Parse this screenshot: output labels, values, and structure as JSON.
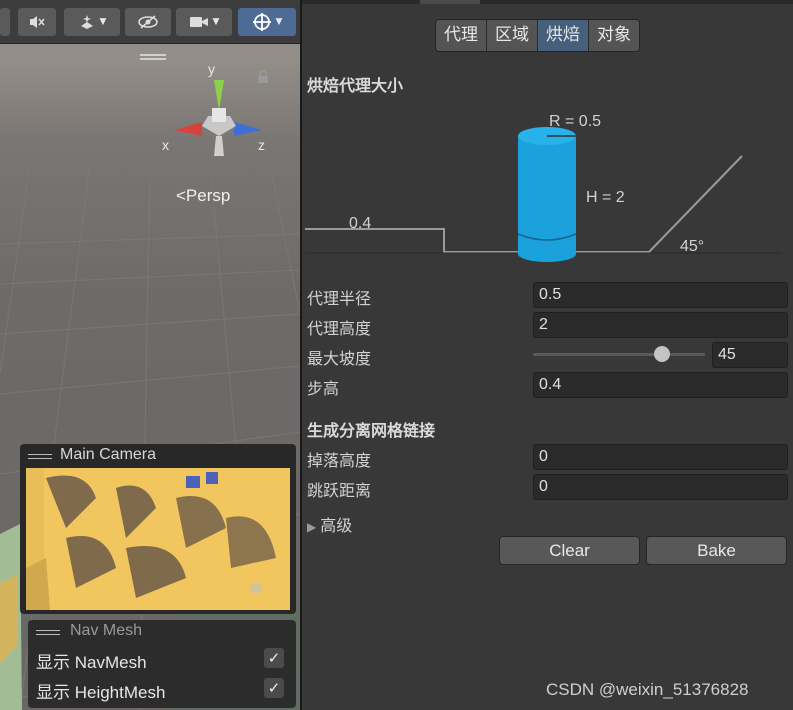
{
  "scene": {
    "gizmo": {
      "y_label": "y",
      "x_label": "x",
      "z_label": "z"
    },
    "persp_label": "<Persp",
    "camera_overlay": {
      "title": "Main Camera"
    },
    "navmesh_overlay": {
      "title": "Nav Mesh",
      "rows": [
        {
          "label": "显示 NavMesh",
          "checked": true
        },
        {
          "label": "显示 HeightMesh",
          "checked": true
        }
      ]
    },
    "toolbar_icons": [
      "audio-mute-icon",
      "effects-icon",
      "visibility-icon",
      "camera-icon",
      "gizmos-icon"
    ]
  },
  "inspector": {
    "tabs": [
      "代理",
      "区域",
      "烘焙",
      "对象"
    ],
    "active_tab": "烘焙",
    "agent_section": "烘焙代理大小",
    "diagram": {
      "radius_label": "R = 0.5",
      "height_label": "H = 2",
      "step_label": "0.4",
      "slope_label": "45°",
      "cylinder_color": "#1ba1dc"
    },
    "fields": [
      {
        "label": "代理半径",
        "value": "0.5"
      },
      {
        "label": "代理高度",
        "value": "2"
      },
      {
        "label": "最大坡度",
        "value": "45",
        "slider_fraction": 0.75
      },
      {
        "label": "步高",
        "value": "0.4"
      }
    ],
    "offmesh_section": "生成分离网格链接",
    "offmesh_fields": [
      {
        "label": "掉落高度",
        "value": "0"
      },
      {
        "label": "跳跃距离",
        "value": "0"
      }
    ],
    "advanced_label": "高级",
    "clear_button": "Clear",
    "bake_button": "Bake",
    "accent_tab_color": "#46607c"
  },
  "watermark": "CSDN @weixin_51376828"
}
